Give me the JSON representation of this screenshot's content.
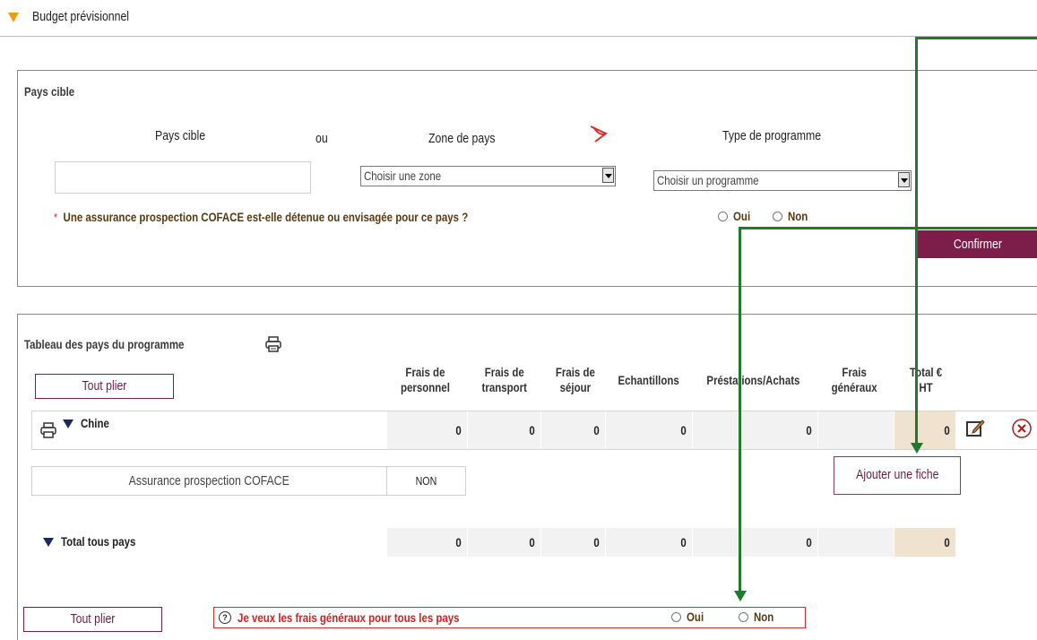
{
  "header": {
    "title": "Budget prévisionnel"
  },
  "pays_section": {
    "title": "Pays cible",
    "label_pays": "Pays cible",
    "label_ou": "ou",
    "label_zone": "Zone de pays",
    "label_type": "Type de programme",
    "pays_value": "",
    "zone_selected": "Choisir une zone",
    "programme_selected": "Choisir un programme",
    "question_star": "*",
    "question": "Une assurance prospection COFACE est-elle détenue ou envisagée pour ce pays ?",
    "oui": "Oui",
    "non": "Non",
    "confirm_label": "Confirmer"
  },
  "table_section": {
    "title": "Tableau des pays du programme",
    "tout_plier": "Tout plier",
    "headers": [
      {
        "l1": "Frais de",
        "l2": "personnel"
      },
      {
        "l1": "Frais de",
        "l2": "transport"
      },
      {
        "l1": "Frais de",
        "l2": "séjour"
      },
      {
        "l1": "Echantillons",
        "l2": ""
      },
      {
        "l1": "Préstations/Achats",
        "l2": ""
      },
      {
        "l1": "Frais",
        "l2": "généraux"
      },
      {
        "l1": "Total €",
        "l2": "HT"
      }
    ],
    "country_row": {
      "name": "Chine",
      "values": [
        "0",
        "0",
        "0",
        "0",
        "",
        "0",
        "",
        "0"
      ]
    },
    "assurance_label": "Assurance prospection COFACE",
    "assurance_value": "NON",
    "ajouter_fiche": "Ajouter une fiche",
    "total_row": {
      "name": "Total tous pays",
      "values": [
        "0",
        "0",
        "0",
        "0",
        "",
        "0",
        "",
        "0"
      ]
    }
  },
  "footer": {
    "tout_plier": "Tout plier",
    "help_glyph": "?",
    "frais_question": "Je veux les frais généraux pour tous les pays",
    "oui": "Oui",
    "non": "Non"
  },
  "colors": {
    "accent": "#7b1e4a",
    "orange": "#f39c12",
    "arrow_green": "#1f7a2e",
    "navy": "#1b2a5e"
  }
}
